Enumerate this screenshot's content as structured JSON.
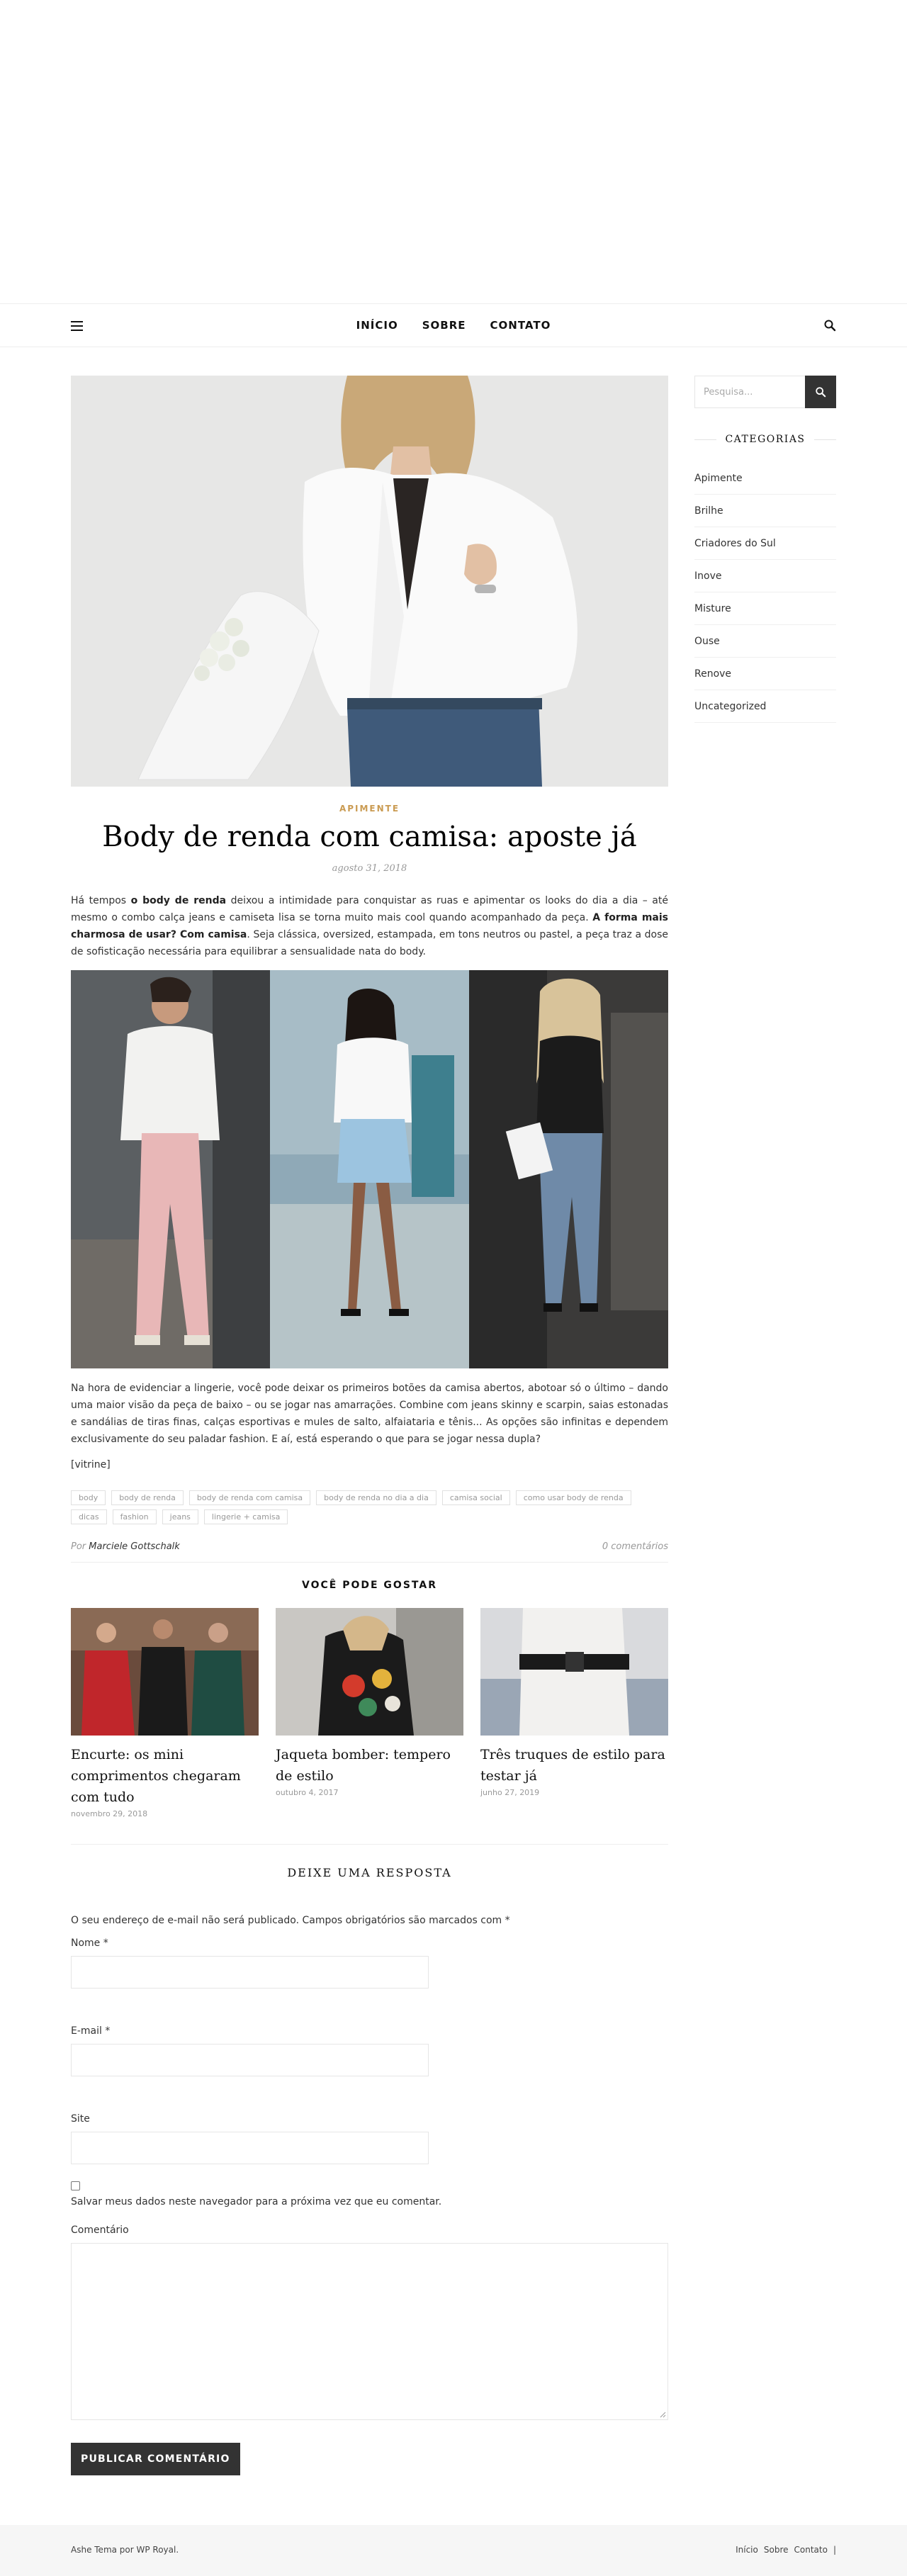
{
  "nav": {
    "links": [
      "INÍCIO",
      "SOBRE",
      "CONTATO"
    ]
  },
  "post": {
    "category": "APIMENTE",
    "title": "Body de renda com camisa: aposte já",
    "date": "agosto 31, 2018",
    "intro_parts": [
      "Há tempos ",
      "o body de renda",
      " deixou a intimidade para conquistar as ruas e apimentar os looks do dia a dia – até mesmo o combo calça jeans e camiseta lisa se torna muito mais cool quando acompanhado da peça. ",
      "A forma mais charmosa de usar? Com camisa",
      ". Seja clássica, oversized, estampada, em tons neutros ou pastel, a peça traz a dose de sofisticação necessária para equilibrar a sensualidade nata do body."
    ],
    "body_text": "Na hora de evidenciar a lingerie, você pode deixar os primeiros botões da camisa abertos, abotoar só o último – dando uma maior visão da peça de baixo – ou se jogar nas amarrações. Combine com jeans skinny e scarpin, saias estonadas e sandálias de tiras finas, calças esportivas e mules de salto, alfaiataria e tênis... As opções são infinitas e dependem exclusivamente do seu paladar fashion. E aí, está esperando o que para se jogar nessa dupla?",
    "vitrine": "[vitrine]",
    "tags": [
      "body",
      "body de renda",
      "body de renda com camisa",
      "body de renda no dia a dia",
      "camisa social",
      "como usar body de renda",
      "dicas",
      "fashion",
      "jeans",
      "lingerie + camisa"
    ],
    "author_prefix": "Por",
    "author": "Marciele Gottschalk",
    "comments": "0 comentários"
  },
  "related": {
    "heading": "VOCÊ PODE GOSTAR",
    "items": [
      {
        "title": "Encurte: os mini comprimentos chegaram com tudo",
        "date": "novembro 29, 2018"
      },
      {
        "title": "Jaqueta bomber: tempero de estilo",
        "date": "outubro 4, 2017"
      },
      {
        "title": "Três truques de estilo para testar já",
        "date": "junho 27, 2019"
      }
    ]
  },
  "reply": {
    "heading": "DEIXE UMA RESPOSTA",
    "notes": "O seu endereço de e-mail não será publicado. Campos obrigatórios são marcados com *",
    "name_label": "Nome *",
    "email_label": "E-mail *",
    "site_label": "Site",
    "save_label": "Salvar meus dados neste navegador para a próxima vez que eu comentar.",
    "comment_label": "Comentário",
    "submit_label": "PUBLICAR COMENTÁRIO"
  },
  "sidebar": {
    "search_placeholder": "Pesquisa...",
    "categories_heading": "CATEGORIAS",
    "categories": [
      "Apimente",
      "Brilhe",
      "Criadores do Sul",
      "Inove",
      "Misture",
      "Ouse",
      "Renove",
      "Uncategorized"
    ]
  },
  "footer": {
    "credit": "Ashe Tema por WP Royal.",
    "links": [
      "Início",
      "Sobre",
      "Contato",
      "|"
    ]
  },
  "colors": {
    "accent": "#ca9b52",
    "dark": "#333333",
    "footer_bg": "#f6f6f6"
  },
  "icons": [
    "hamburger-menu-icon",
    "search-icon"
  ]
}
